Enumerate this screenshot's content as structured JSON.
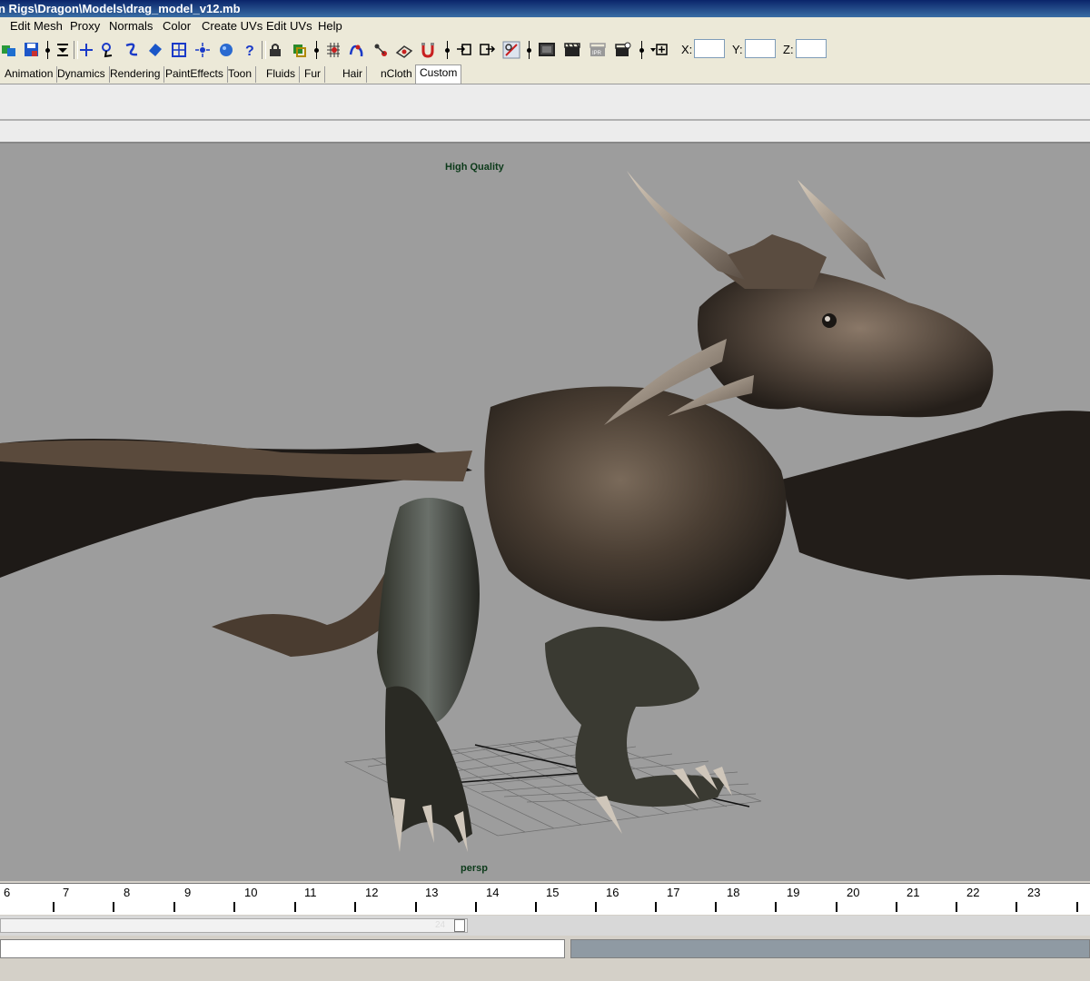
{
  "window": {
    "title": "n Rigs\\Dragon\\Models\\drag_model_v12.mb"
  },
  "menu": [
    "Edit Mesh",
    "Proxy",
    "Normals",
    "Color",
    "Create UVs",
    "Edit UVs",
    "Help"
  ],
  "toolbar": {
    "icons": [
      "new-scene-icon",
      "save-scene-icon",
      "menu-set-icon",
      "move-icon",
      "lasso-icon",
      "curve-icon",
      "paint-icon",
      "snap-grid-icon",
      "light-icon",
      "render-sphere-icon",
      "help-icon",
      "lock-icon",
      "select-by-component-icon",
      "snap-to-grid-icon",
      "snap-to-curve-icon",
      "snap-to-point-icon",
      "snap-to-view-plane-icon",
      "make-live-icon",
      "input-ops-icon",
      "output-ops-icon",
      "construction-history-icon",
      "render-view-icon",
      "render-current-frame-icon",
      "ipr-render-icon",
      "render-settings-icon",
      "transform-mode-icon"
    ],
    "x_label": "X:",
    "y_label": "Y:",
    "z_label": "Z:",
    "x_value": "",
    "y_value": "",
    "z_value": ""
  },
  "shelf_tabs": [
    "Animation",
    "Dynamics",
    "Rendering",
    "PaintEffects",
    "Toon",
    "Fluids",
    "Fur",
    "Hair",
    "nCloth",
    "Custom"
  ],
  "active_shelf_tab": "Custom",
  "viewport": {
    "quality_label": "High Quality",
    "camera_label": "persp"
  },
  "timeline": {
    "ticks": [
      "6",
      "7",
      "8",
      "9",
      "10",
      "11",
      "12",
      "13",
      "14",
      "15",
      "16",
      "17",
      "18",
      "19",
      "20",
      "21",
      "22",
      "23"
    ]
  },
  "range_slider": {
    "current_label": "24"
  },
  "colors": {
    "viewport_bg": "#9d9d9d",
    "hud_text": "#0c3a1a",
    "title_bar": "#0a246a"
  }
}
